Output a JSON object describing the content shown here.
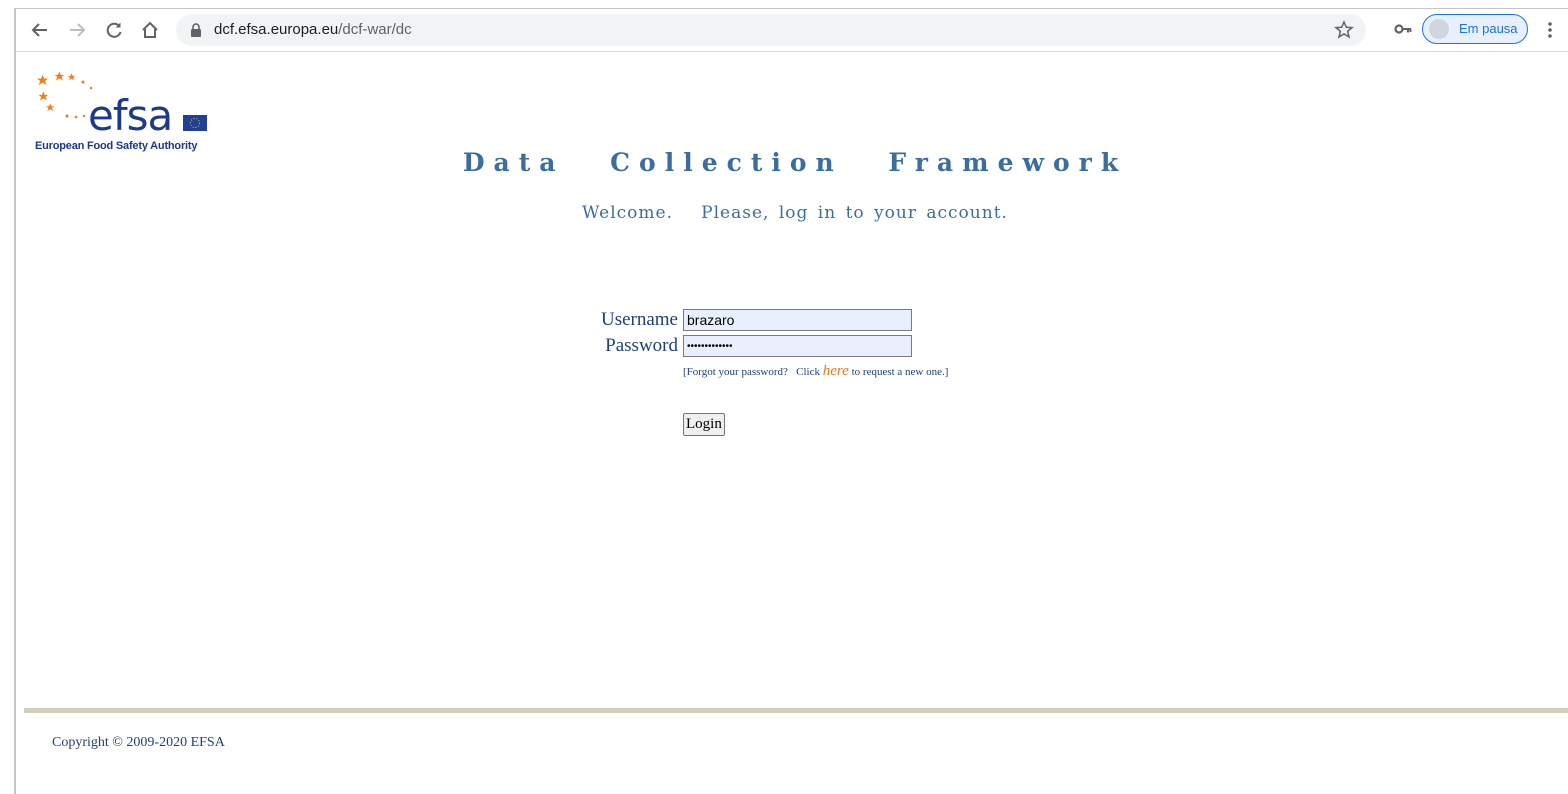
{
  "browser": {
    "url_host": "dcf.efsa.europa.eu",
    "url_path": "/dcf-war/dc",
    "profile_label": "Em pausa"
  },
  "logo": {
    "wordmark": "efsa",
    "tagline": "European Food Safety Authority",
    "colors": {
      "wordmark": "#1d3a8a",
      "stars": "#f07f1f",
      "flag": "#1f3f99"
    }
  },
  "page": {
    "title": "Data Collection Framework",
    "welcome": "Welcome.   Please, log in to your account."
  },
  "login_form": {
    "username_label": "Username",
    "username_value": "brazaro",
    "password_label": "Password",
    "password_value": "•••••••••••••",
    "forgot_prefix": "[Forgot your password?   Click ",
    "forgot_link": "here",
    "forgot_suffix": " to request a new one.]",
    "login_button": "Login"
  },
  "footer": {
    "copyright": "Copyright © 2009-2020 EFSA"
  },
  "colors": {
    "heading": "#3a6e9e",
    "label": "#1f3f7a",
    "link": "#e8741a",
    "footer_rule": "#d2d0b8"
  }
}
